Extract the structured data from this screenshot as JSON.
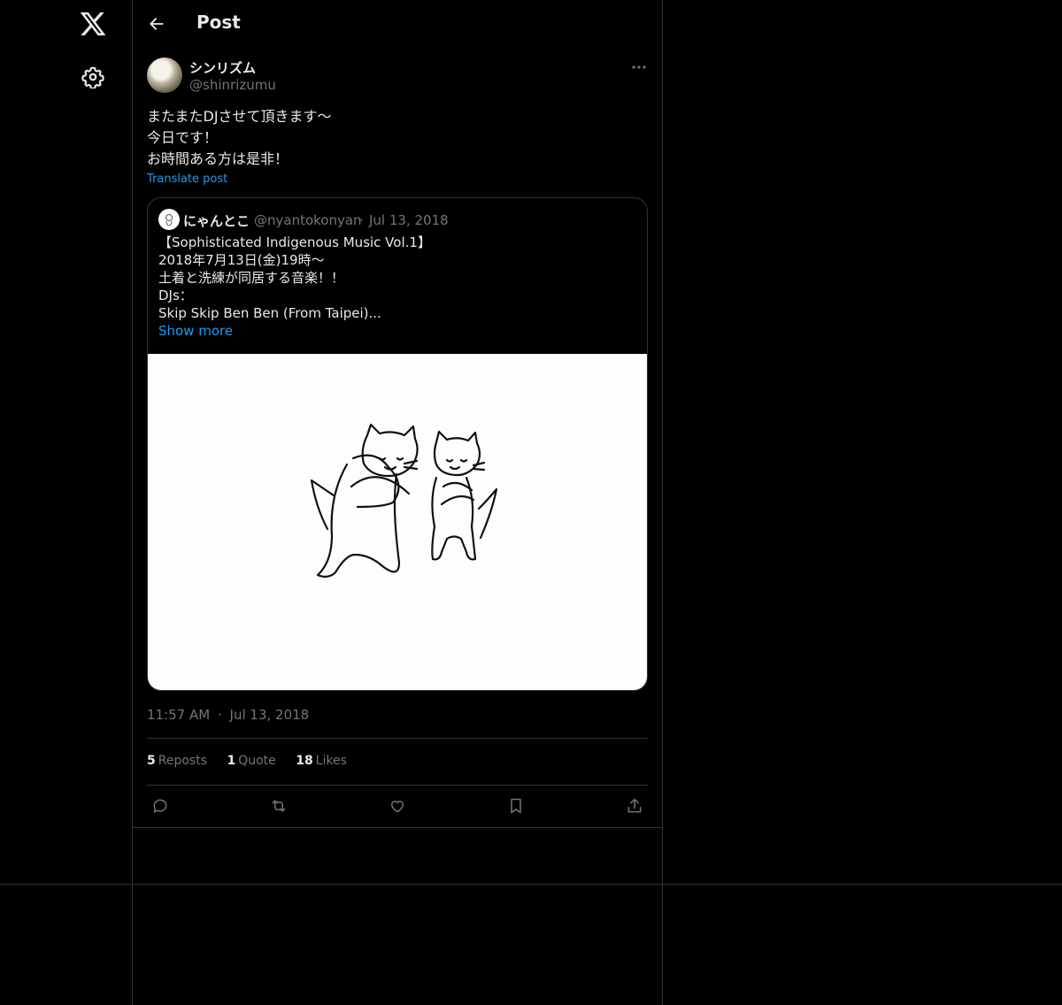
{
  "header": {
    "title": "Post"
  },
  "post": {
    "display_name": "シンリズム",
    "handle": "@shinrizumu",
    "text_lines": [
      "またまたDJさせて頂きます〜",
      "今日です！",
      "お時間ある方は是非！"
    ],
    "translate_label": "Translate post",
    "time": "11:57 AM",
    "separator": "·",
    "date": "Jul 13, 2018",
    "stats": {
      "reposts_count": "5",
      "reposts_label": "Reposts",
      "quotes_count": "1",
      "quotes_label": "Quote",
      "likes_count": "18",
      "likes_label": "Likes"
    }
  },
  "quote": {
    "display_name": "にゃんとこ",
    "handle": "@nyantokonyan",
    "separator": "·",
    "date": "Jul 13, 2018",
    "text_lines": [
      "【Sophisticated Indigenous Music Vol.1】",
      "2018年7月13日(金)19時〜",
      "土着と洗練が同居する音楽！！",
      "DJs：",
      "Skip Skip Ben Ben (From Taipei)..."
    ],
    "show_more": "Show more"
  },
  "colors": {
    "background": "#000000",
    "text": "#e7e9ea",
    "secondary": "#71767b",
    "accent": "#1d9bf0",
    "border": "#2f3336"
  },
  "icons": [
    "x-logo-icon",
    "gear-icon",
    "back-arrow-icon",
    "more-dots-icon",
    "reply-icon",
    "repost-icon",
    "like-icon",
    "bookmark-icon",
    "share-icon"
  ]
}
